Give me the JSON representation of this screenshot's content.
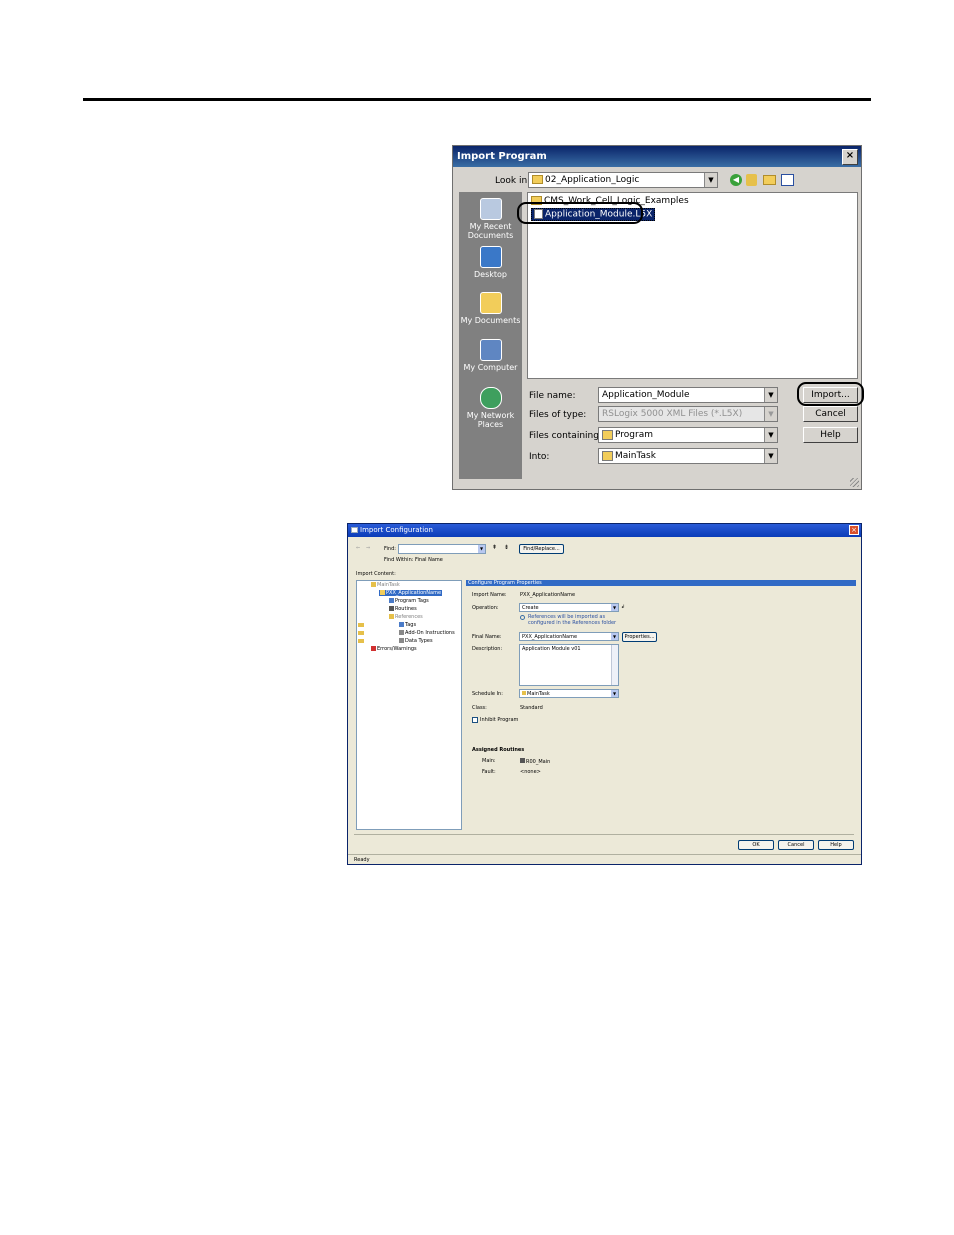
{
  "import_program": {
    "title": "Import Program",
    "close_glyph": "×",
    "look_in_label": "Look in:",
    "look_in_value": "02_Application_Logic",
    "places": [
      {
        "label": "My Recent Documents",
        "icon": "recent-documents-icon"
      },
      {
        "label": "Desktop",
        "icon": "desktop-icon"
      },
      {
        "label": "My Documents",
        "icon": "my-documents-icon"
      },
      {
        "label": "My Computer",
        "icon": "my-computer-icon"
      },
      {
        "label": "My Network Places",
        "icon": "network-places-icon"
      }
    ],
    "files": [
      {
        "name": "CMS_Work_Cell_Logic_Examples",
        "type": "folder"
      },
      {
        "name": "Application_Module.L5X",
        "type": "file",
        "selected": true
      }
    ],
    "file_name_label": "File name:",
    "file_name_value": "Application_Module",
    "files_of_type_label": "Files of type:",
    "files_of_type_value": "RSLogix 5000 XML Files (*.L5X)",
    "files_containing_label": "Files containing:",
    "files_containing_value": "Program",
    "into_label": "Into:",
    "into_value": "MainTask",
    "buttons": {
      "import": "Import...",
      "cancel": "Cancel",
      "help": "Help"
    }
  },
  "import_configuration": {
    "title": "Import Configuration",
    "find_label": "Find:",
    "find_value": "",
    "find_within": "Find Within: Final Name",
    "find_replace_button": "Find/Replace...",
    "import_content_label": "Import Content:",
    "tree": [
      {
        "label": "MainTask",
        "indent": 1
      },
      {
        "label": "PXX_ApplicationName",
        "indent": 2,
        "selected": true
      },
      {
        "label": "Program Tags",
        "indent": 3
      },
      {
        "label": "Routines",
        "indent": 3
      },
      {
        "label": "References",
        "indent": 3
      },
      {
        "label": "Tags",
        "indent": 4
      },
      {
        "label": "Add-On Instructions",
        "indent": 4
      },
      {
        "label": "Data Types",
        "indent": 4
      },
      {
        "label": "Errors/Warnings",
        "indent": 1
      }
    ],
    "panel_header": "Configure Program Properties",
    "import_name_label": "Import Name:",
    "import_name_value": "PXX_ApplicationName",
    "operation_label": "Operation:",
    "operation_value": "Create",
    "references_note_1": "References will be imported as",
    "references_note_2": "configured in the References folder",
    "final_name_label": "Final Name:",
    "final_name_value": "PXX_ApplicationName",
    "properties_button": "Properties...",
    "description_label": "Description:",
    "description_value": "Application Module v01",
    "schedule_in_label": "Schedule In:",
    "schedule_in_value": "MainTask",
    "class_label": "Class:",
    "class_value": "Standard",
    "inhibit_label": "Inhibit Program",
    "assigned_routines_label": "Assigned Routines",
    "main_label": "Main:",
    "main_value": "R00_Main",
    "fault_label": "Fault:",
    "fault_value": "<none>",
    "buttons": {
      "ok": "OK",
      "cancel": "Cancel",
      "help": "Help"
    },
    "status": "Ready"
  }
}
